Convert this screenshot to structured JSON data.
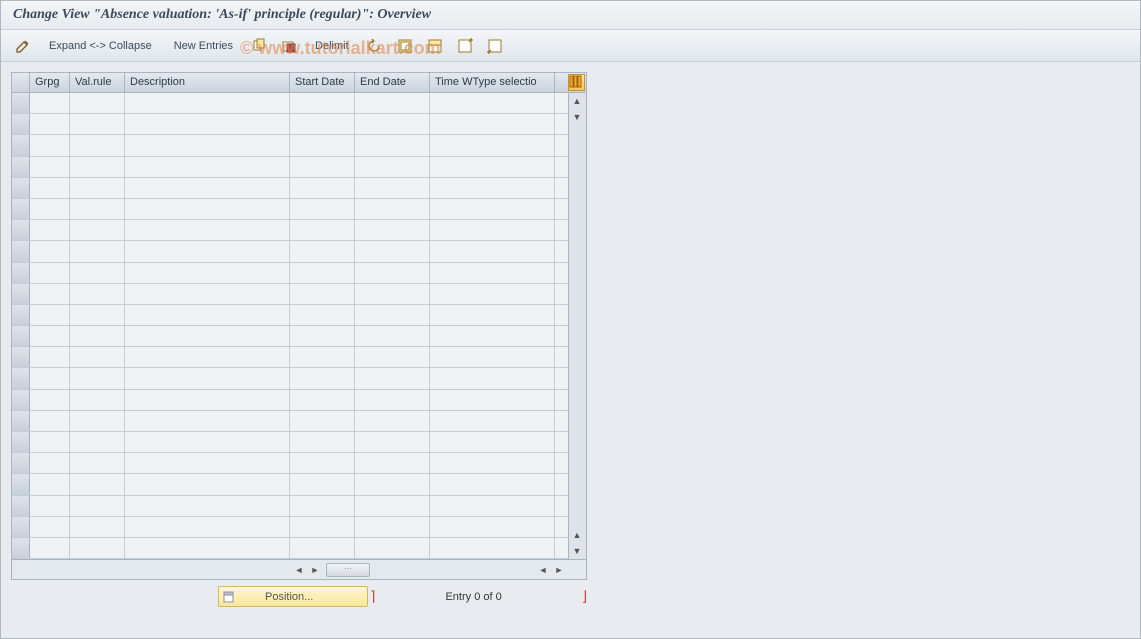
{
  "title": "Change View \"Absence valuation: 'As-if' principle (regular)\": Overview",
  "toolbar": {
    "expand_collapse": "Expand <-> Collapse",
    "new_entries": "New Entries",
    "delimit": "Delimit"
  },
  "watermark": "© www.tutorialkart.com",
  "grid": {
    "columns": {
      "grpg": "Grpg",
      "valrule": "Val.rule",
      "description": "Description",
      "start_date": "Start Date",
      "end_date": "End Date",
      "time_wtype": "Time WType selectio"
    },
    "rows": []
  },
  "footer": {
    "position_btn": "Position...",
    "entry_text": "Entry 0 of 0"
  }
}
